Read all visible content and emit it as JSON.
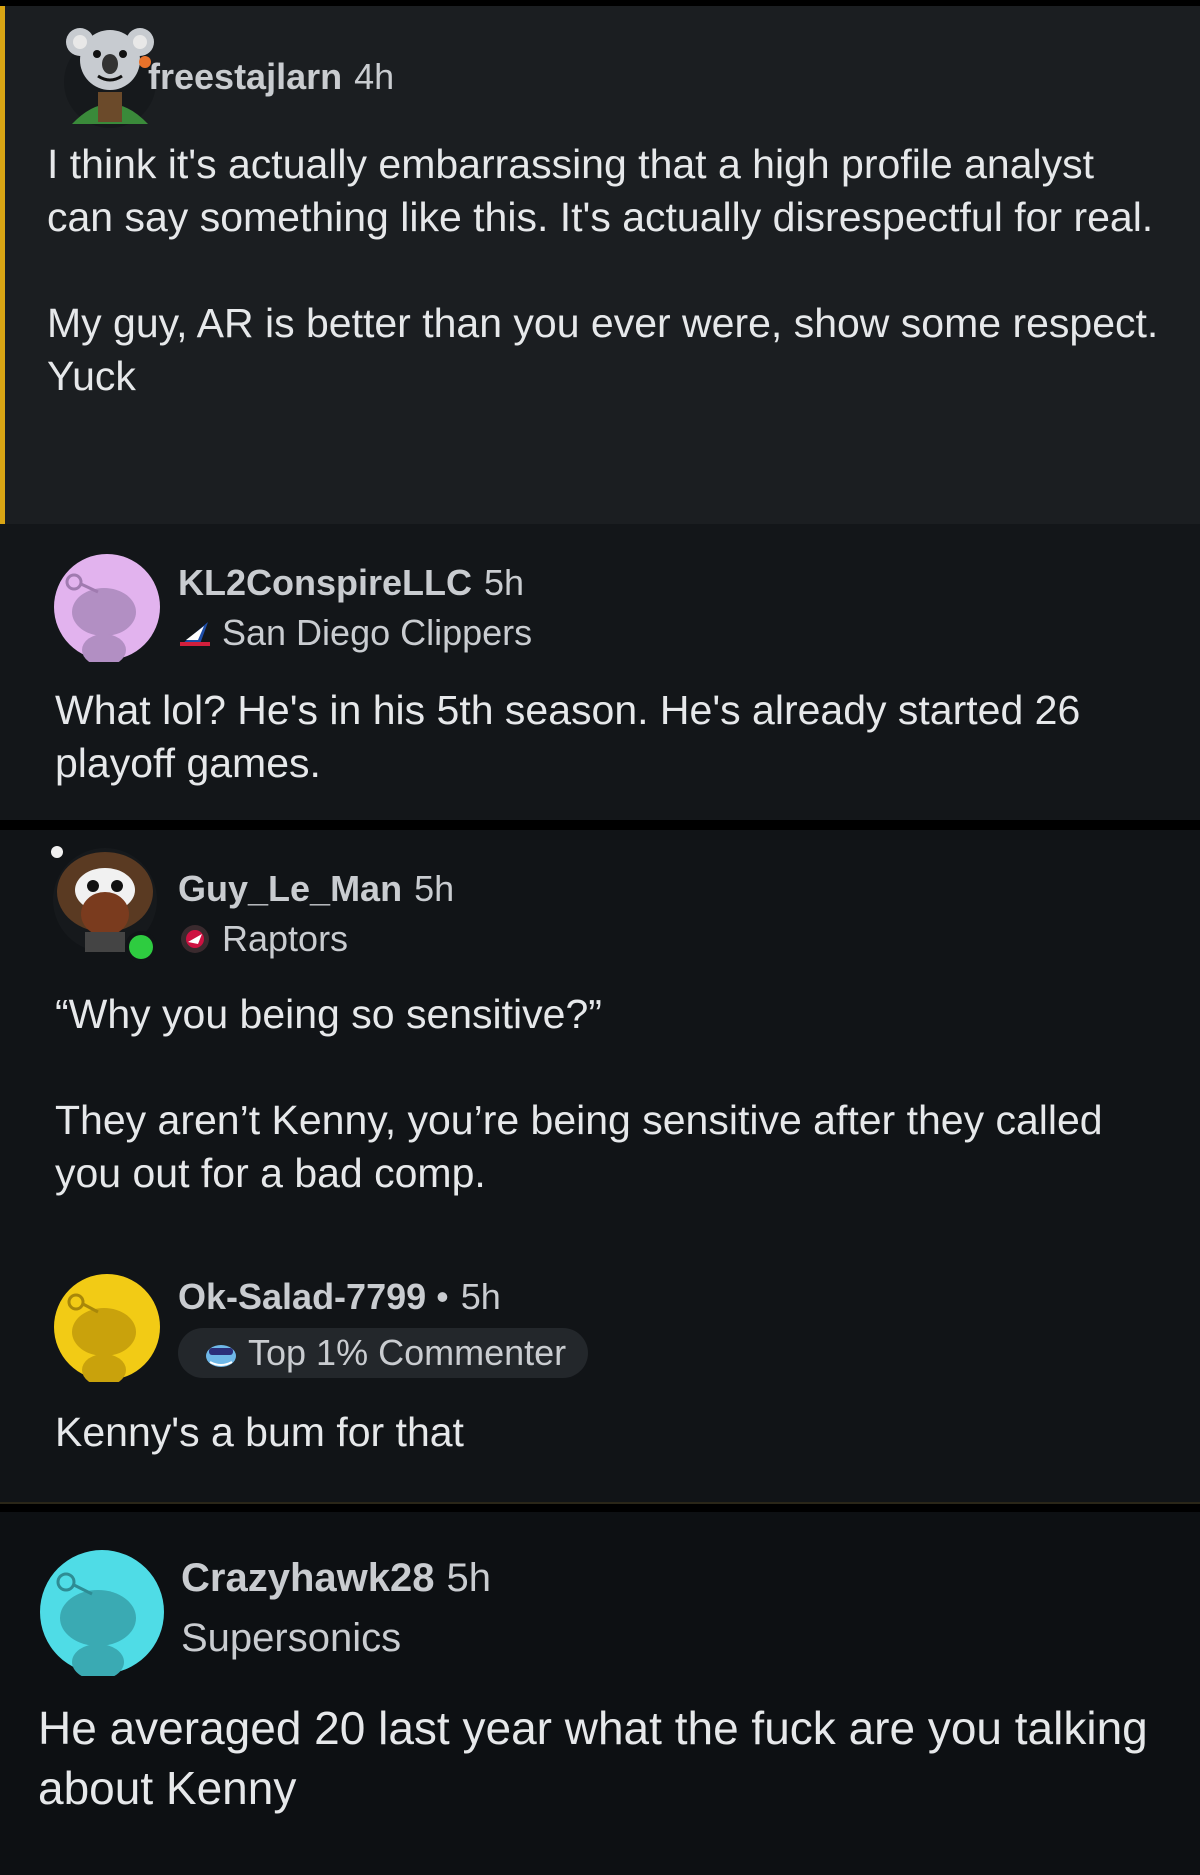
{
  "comments": [
    {
      "username": "freestajlarn",
      "time": "4h",
      "avatar": "koala-snoo-avatar",
      "body": "I think it's actually embarrassing that a high profile analyst can say something like this. It's actually disrespectful for real.\n\nMy guy, AR is better than you ever were, show some respect. Yuck",
      "highlight_color": "#d9a514"
    },
    {
      "username": "KL2ConspireLLC",
      "time": "5h",
      "avatar": "purple-snoo-avatar",
      "flair": "San Diego Clippers",
      "flair_icon": "clippers-logo-icon",
      "body": "What lol? He's in his 5th season. He's already started 26 playoff games."
    },
    {
      "username": "Guy_Le_Man",
      "time": "5h",
      "avatar": "bearded-snoo-avatar",
      "online_status_color": "#2ecc40",
      "flair": "Raptors",
      "flair_icon": "raptors-logo-icon",
      "body": "“Why you being so sensitive?”\n\nThey aren’t Kenny, you’re being sensitive after they called you out for a bad comp."
    },
    {
      "username": "Ok-Salad-7799",
      "separator": "•",
      "time": "5h",
      "avatar": "yellow-snoo-avatar",
      "flair": "Top 1% Commenter",
      "flair_icon": "top-commenter-icon",
      "body": "Kenny's a bum for that"
    },
    {
      "username": "Crazyhawk28",
      "time": "5h",
      "avatar": "cyan-snoo-avatar",
      "flair": "Supersonics",
      "body": "He averaged 20 last year what the fuck are you talking about Kenny"
    }
  ]
}
